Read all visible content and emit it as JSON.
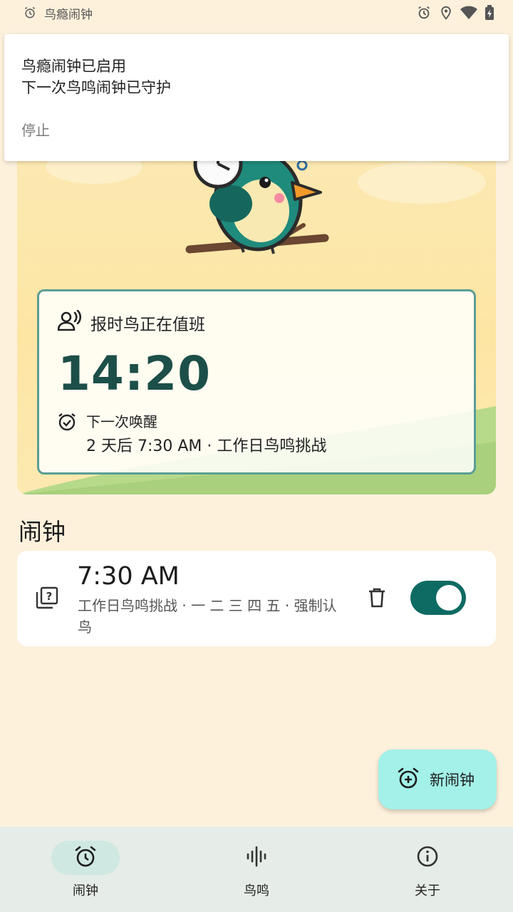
{
  "status_bar": {
    "app_name": "鸟瘾闹钟",
    "icons": [
      "alarm-icon",
      "location-icon",
      "wifi-icon",
      "battery-icon"
    ]
  },
  "notification": {
    "title": "鸟瘾闹钟已启用",
    "text": "下一次鸟鸣闹钟已守护",
    "action_label": "停止"
  },
  "duty_card": {
    "header": "报时鸟正在值班",
    "current_time": "14:20",
    "next_label": "下一次唤醒",
    "next_detail": "2 天后 7:30 AM · 工作日鸟鸣挑战"
  },
  "alarms_section": {
    "title": "闹钟",
    "alarms": [
      {
        "time": "7:30 AM",
        "description": "工作日鸟鸣挑战 · 一 二 三 四 五 · 强制认鸟",
        "enabled": true
      }
    ]
  },
  "fab": {
    "label": "新闹钟"
  },
  "bottom_nav": {
    "items": [
      {
        "label": "闹钟",
        "icon": "alarm-clock-icon",
        "active": true
      },
      {
        "label": "鸟鸣",
        "icon": "waveform-icon",
        "active": false
      },
      {
        "label": "关于",
        "icon": "info-icon",
        "active": false
      }
    ]
  },
  "colors": {
    "accent": "#0e6b63",
    "fab": "#a3f1e8",
    "background": "#fdf1dc",
    "time_text": "#1c4f49"
  }
}
